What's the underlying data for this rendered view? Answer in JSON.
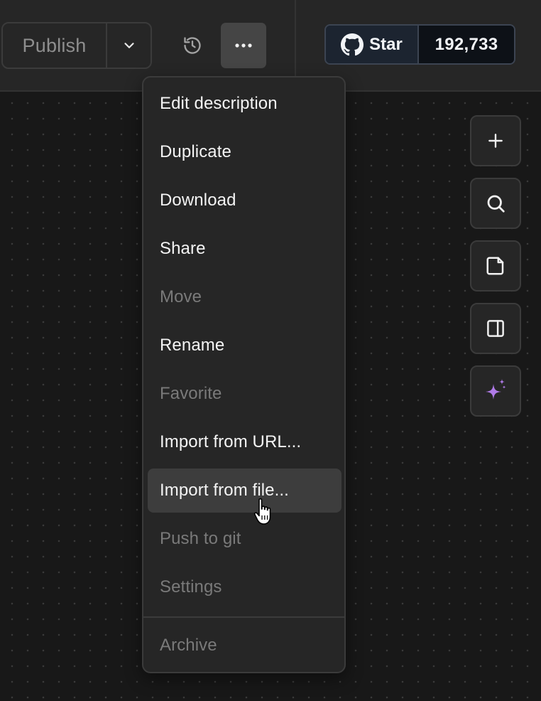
{
  "toolbar": {
    "publish_label": "Publish",
    "publish_caret_icon": "chevron-down-icon",
    "history_icon": "history-icon",
    "more_icon": "more-horizontal-icon"
  },
  "github": {
    "icon": "github-icon",
    "star_label": "Star",
    "star_count": "192,733"
  },
  "menu": {
    "items": [
      {
        "label": "Edit description",
        "enabled": true
      },
      {
        "label": "Duplicate",
        "enabled": true
      },
      {
        "label": "Download",
        "enabled": true
      },
      {
        "label": "Share",
        "enabled": true
      },
      {
        "label": "Move",
        "enabled": false
      },
      {
        "label": "Rename",
        "enabled": true
      },
      {
        "label": "Favorite",
        "enabled": false
      },
      {
        "label": "Import from URL...",
        "enabled": true
      },
      {
        "label": "Import from file...",
        "enabled": true,
        "hovered": true
      },
      {
        "label": "Push to git",
        "enabled": false
      },
      {
        "label": "Settings",
        "enabled": false
      },
      {
        "label": "Archive",
        "enabled": false
      }
    ]
  },
  "side_toolbar": {
    "buttons": [
      {
        "icon": "plus-icon"
      },
      {
        "icon": "search-icon"
      },
      {
        "icon": "sticky-note-icon"
      },
      {
        "icon": "panel-right-icon"
      },
      {
        "icon": "sparkle-icon"
      }
    ]
  },
  "colors": {
    "background": "#181818",
    "topbar": "#262626",
    "menu_background": "#262626",
    "menu_hover": "#3d3d3d",
    "text_primary": "#f4f4f4",
    "text_disabled": "#7a7a7a",
    "sparkle_accent": "#b07be8",
    "github_star_bg": "#1c2430",
    "github_count_bg": "#0d1117"
  }
}
